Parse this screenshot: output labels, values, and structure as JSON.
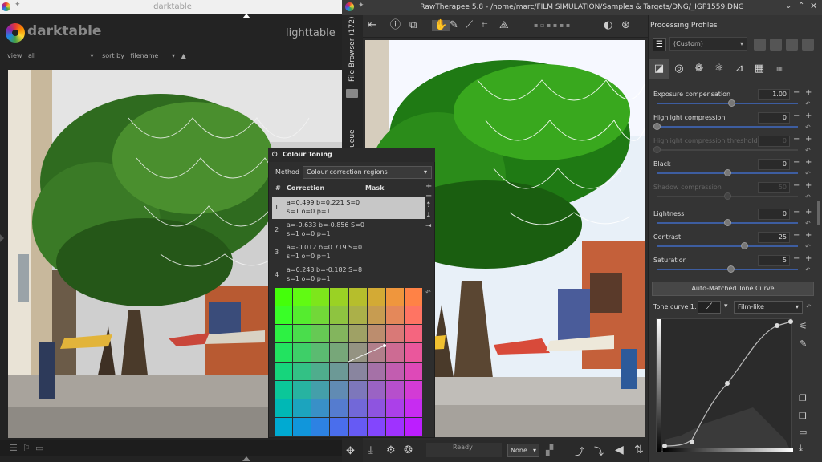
{
  "darktable": {
    "title": "darktable",
    "app_name": "darktable",
    "view": "lighttable",
    "filter": {
      "view_label": "view",
      "view_value": "all",
      "sort_label": "sort by",
      "sort_value": "filename"
    }
  },
  "rawtherapee": {
    "title": "RawTherapee 5.8 - /home/marc/FILM SIMULATION/Samples & Targets/DNG/_IGP1559.DNG",
    "side_tabs": {
      "file_browser": "File Browser (172)",
      "queue": "Queue"
    },
    "status": "Ready",
    "none_select": "None",
    "processing_profiles": {
      "title": "Processing Profiles",
      "selected": "(Custom)"
    },
    "exposure": [
      {
        "label": "Exposure compensation",
        "value": "1.00",
        "dim": false,
        "pos": 0.53
      },
      {
        "label": "Highlight compression",
        "value": "0",
        "dim": false,
        "pos": 0.0
      },
      {
        "label": "Highlight compression threshold",
        "value": "0",
        "dim": true,
        "pos": 0.0
      },
      {
        "label": "Black",
        "value": "0",
        "dim": false,
        "pos": 0.5
      },
      {
        "label": "Shadow compression",
        "value": "50",
        "dim": true,
        "pos": 0.5
      },
      {
        "label": "Lightness",
        "value": "0",
        "dim": false,
        "pos": 0.5
      },
      {
        "label": "Contrast",
        "value": "25",
        "dim": false,
        "pos": 0.62
      },
      {
        "label": "Saturation",
        "value": "5",
        "dim": false,
        "pos": 0.52
      }
    ],
    "auto_matched": "Auto-Matched Tone Curve",
    "tone_curve": {
      "label": "Tone curve 1:",
      "type": "Film-like"
    }
  },
  "colour_toning": {
    "title": "Colour Toning",
    "method_label": "Method",
    "method_value": "Colour correction regions",
    "columns": {
      "num": "#",
      "correction": "Correction",
      "mask": "Mask"
    },
    "rows": [
      {
        "n": "1",
        "line1": "a=0.499 b=0.221 S=0",
        "line2": "s=1 o=0 p=1"
      },
      {
        "n": "2",
        "line1": "a=-0.633 b=-0.856 S=0",
        "line2": "s=1 o=0 p=1"
      },
      {
        "n": "3",
        "line1": "a=-0.012 b=0.719 S=0",
        "line2": "s=1 o=0 p=1"
      },
      {
        "n": "4",
        "line1": "a=0.243 b=-0.182 S=8",
        "line2": "s=1 o=0 p=1"
      }
    ]
  }
}
